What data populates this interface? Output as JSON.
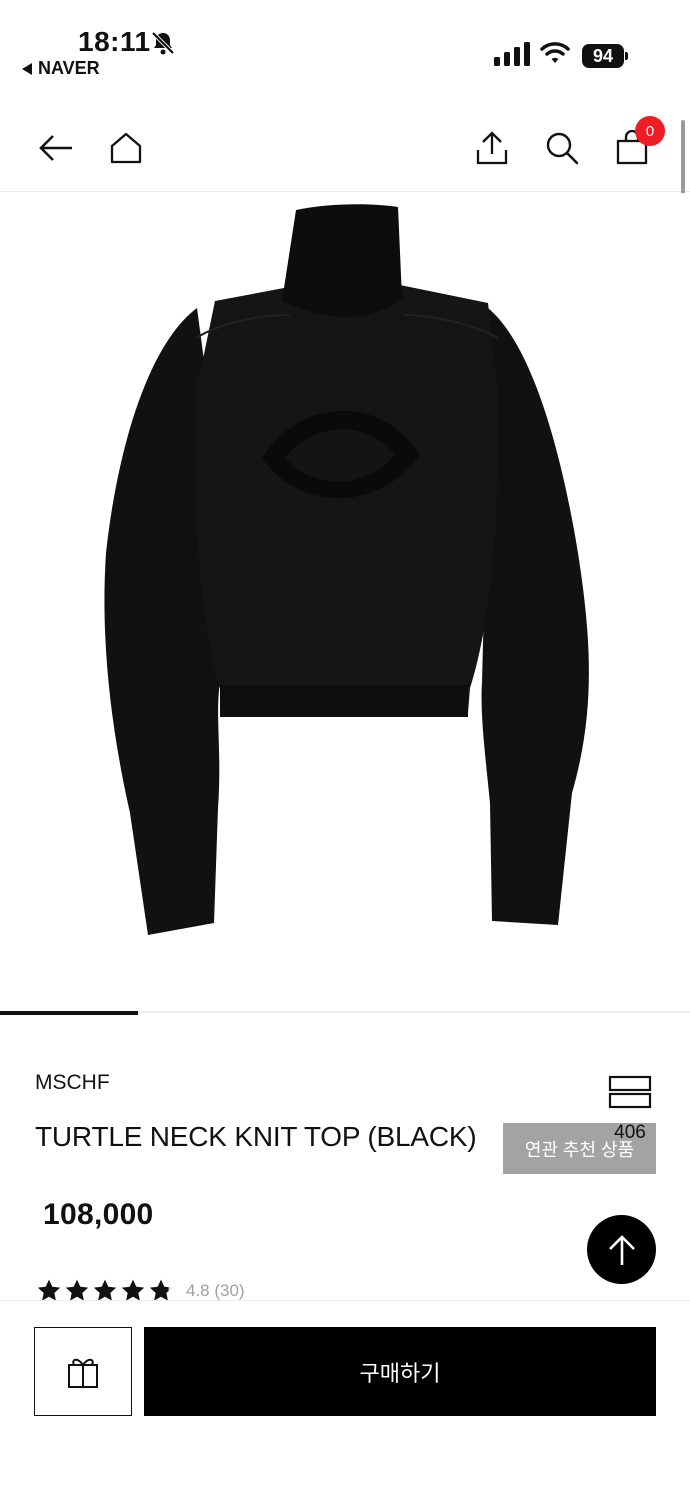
{
  "status_bar": {
    "time": "18:11",
    "back_app": "NAVER",
    "battery": "94"
  },
  "nav": {
    "cart_count": "0"
  },
  "gallery": {
    "progress": 0.2,
    "related_label": "연관 추천 상품"
  },
  "product": {
    "brand": "MSCHF",
    "name": "TURTLE NECK KNIT TOP (BLACK)",
    "price": "108,000",
    "wish_count": "406",
    "rating_value": 4.8,
    "rating_text": "4.8 (30)"
  },
  "bottom": {
    "buy_label": "구매하기"
  },
  "colors": {
    "badge": "#ee1c25",
    "primary": "#000000",
    "related_bg": "#a3a3a3"
  }
}
